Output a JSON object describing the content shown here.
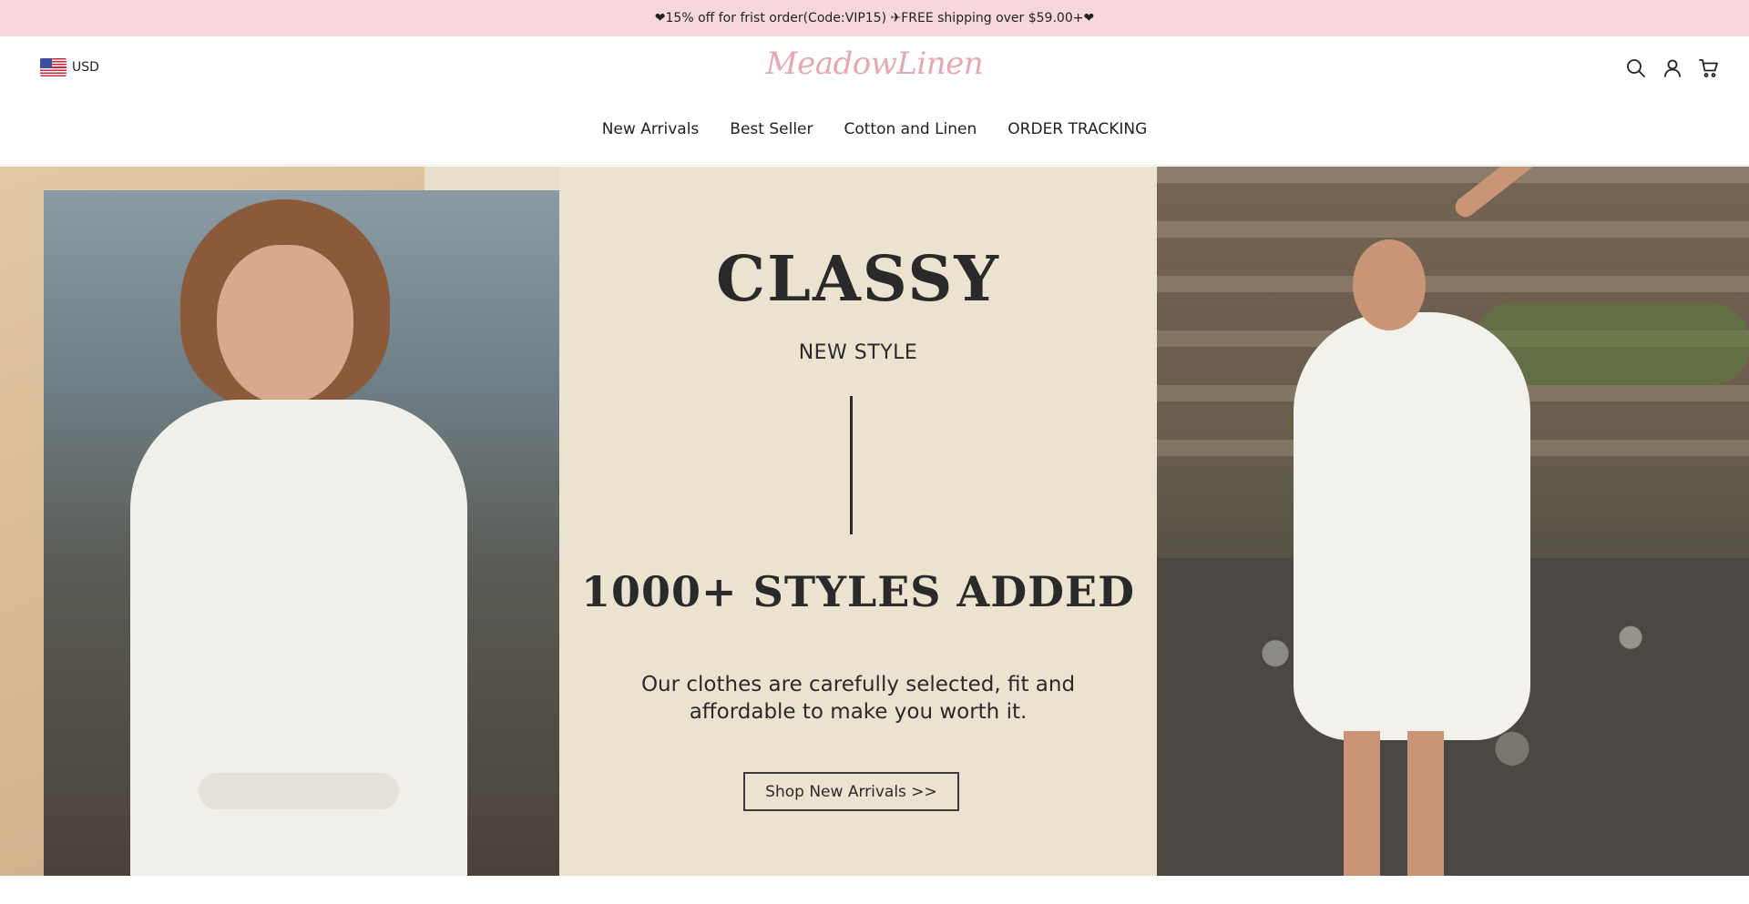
{
  "announcement": {
    "text": "❤15% off for frist order(Code:VIP15) ✈FREE shipping over $59.00+❤"
  },
  "header": {
    "currency": "USD",
    "logo": "MeadowLinen",
    "icons": [
      "search-icon",
      "account-icon",
      "cart-icon"
    ]
  },
  "nav": {
    "items": [
      {
        "label": "New Arrivals"
      },
      {
        "label": "Best Seller"
      },
      {
        "label": "Cotton and Linen"
      },
      {
        "label": "ORDER TRACKING"
      }
    ]
  },
  "hero": {
    "headline": "CLASSY",
    "subheadline": "NEW STYLE",
    "styles_added": "1000+ STYLES ADDED",
    "tagline": "Our clothes are carefully selected,  fit and affordable to make you worth it.",
    "cta": "Shop New Arrivals >>"
  },
  "colors": {
    "announcement_bg": "#f5d7dd",
    "logo": "#e7a7b2",
    "hero_center_bg": "#ebe3d0"
  }
}
